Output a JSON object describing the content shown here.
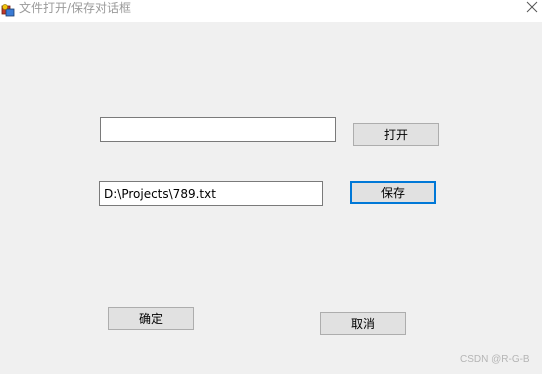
{
  "window": {
    "title": "文件打开/保存对话框",
    "app_icon": "mfc-app-icon",
    "close_icon": "close-icon"
  },
  "dialog": {
    "open_path": {
      "value": "",
      "placeholder": ""
    },
    "open_button_label": "打开",
    "save_path": {
      "value": "D:\\Projects\\789.txt",
      "placeholder": ""
    },
    "save_button_label": "保存",
    "ok_button_label": "确定",
    "cancel_button_label": "取消"
  },
  "watermark": "CSDN @R-G-B",
  "colors": {
    "focus_border": "#0078d7",
    "button_face": "#e1e1e1",
    "dialog_background": "#f0f0f0"
  }
}
